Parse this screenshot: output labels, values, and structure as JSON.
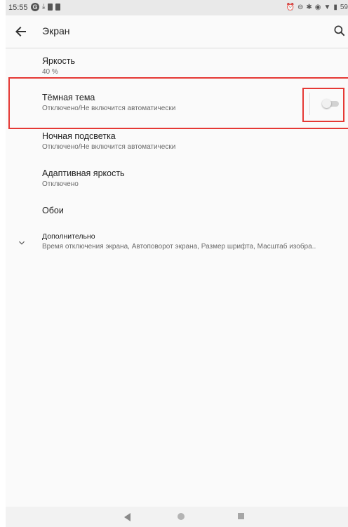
{
  "status_bar": {
    "time": "15:55",
    "right_text": "59",
    "left_icons": [
      "g-icon",
      "download-icon",
      "sim-icon",
      "sd-card-icon"
    ],
    "right_icons": [
      "alarm-icon",
      "dnd-icon",
      "bluetooth-icon",
      "vibrate-icon",
      "wifi-icon",
      "battery-icon"
    ]
  },
  "app_bar": {
    "title": "Экран"
  },
  "settings": [
    {
      "title": "Яркость",
      "summary": "40 %"
    },
    {
      "title": "Тёмная тема",
      "summary": "Отключено/Не включится автоматически",
      "toggle": false
    },
    {
      "title": "Ночная подсветка",
      "summary": "Отключено/Не включится автоматически"
    },
    {
      "title": "Адаптивная яркость",
      "summary": "Отключено"
    },
    {
      "title": "Обои",
      "summary": ""
    },
    {
      "title": "Дополнительно",
      "summary": "Время отключения экрана, Автоповорот экрана, Размер шрифта, Масштаб изобра.."
    }
  ],
  "colors": {
    "highlight": "#e53935",
    "background": "#fafafa",
    "status_bar": "#e9e9e9"
  }
}
